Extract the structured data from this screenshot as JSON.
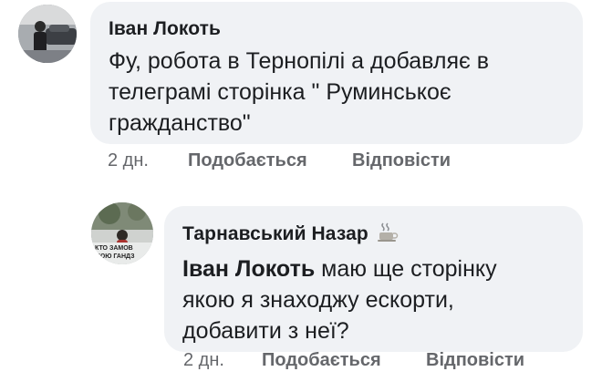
{
  "comments": [
    {
      "author": "Іван Локоть",
      "lines": [
        "Фу, робота в Тернопілі а добавляє в",
        "телеграмі сторінка \" Руминськоє",
        "гражданство\""
      ],
      "time": "2 дн.",
      "like_label": "Подобається",
      "reply_label": "Відповісти"
    },
    {
      "author": "Тарнавський Назар",
      "author_badge_icon": "coffee-cup-icon",
      "mention": "Іван Локоть",
      "lines": [
        " маю ще сторінку",
        "якою я знаходжу ескорти,",
        "добавити з неї?"
      ],
      "time": "2 дн.",
      "like_label": "Подобається",
      "reply_label": "Відповісти",
      "avatar_text": [
        "КТО ЗАМОВ",
        "ЮЮ ГАНДЗ"
      ]
    }
  ],
  "colors": {
    "bubble": "#f0f2f5",
    "meta": "#65676b",
    "text": "#1c1e21"
  }
}
